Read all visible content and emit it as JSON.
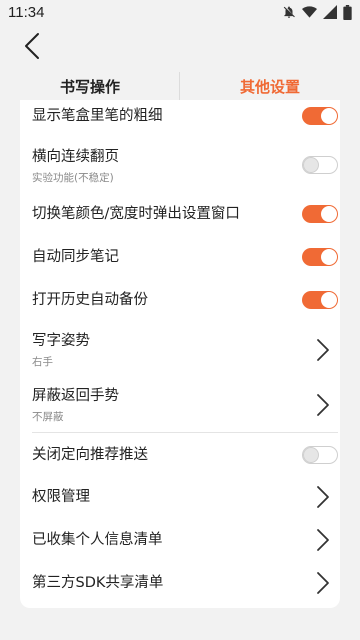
{
  "status_bar": {
    "time": "11:34",
    "icons": [
      "notifications-off-icon",
      "wifi-icon",
      "signal-icon",
      "battery-icon"
    ]
  },
  "nav": {
    "back_icon": "chevron-left-icon"
  },
  "tabs": [
    {
      "label": "书写操作",
      "active": false
    },
    {
      "label": "其他设置",
      "active": true
    }
  ],
  "colors": {
    "accent": "#f06a35",
    "toggle_off": "#e6e6e6",
    "background": "#f2f2f2"
  },
  "settings": {
    "pen_thickness": {
      "label": "显示笔盒里笔的粗细",
      "enabled": true
    },
    "horizontal_flip": {
      "label": "横向连续翻页",
      "sub": "实验功能(不稳定)",
      "enabled": false
    },
    "popup_on_switch": {
      "label": "切换笔颜色/宽度时弹出设置窗口",
      "enabled": true
    },
    "auto_sync": {
      "label": "自动同步笔记",
      "enabled": true
    },
    "auto_backup": {
      "label": "打开历史自动备份",
      "enabled": true
    },
    "writing_posture": {
      "label": "写字姿势",
      "sub": "右手"
    },
    "block_back_gesture": {
      "label": "屏蔽返回手势",
      "sub": "不屏蔽"
    },
    "disable_recommend": {
      "label": "关闭定向推荐推送",
      "enabled": false
    },
    "permissions": {
      "label": "权限管理"
    },
    "personal_info_list": {
      "label": "已收集个人信息清单"
    },
    "third_party_sdk_list": {
      "label": "第三方SDK共享清单"
    }
  }
}
